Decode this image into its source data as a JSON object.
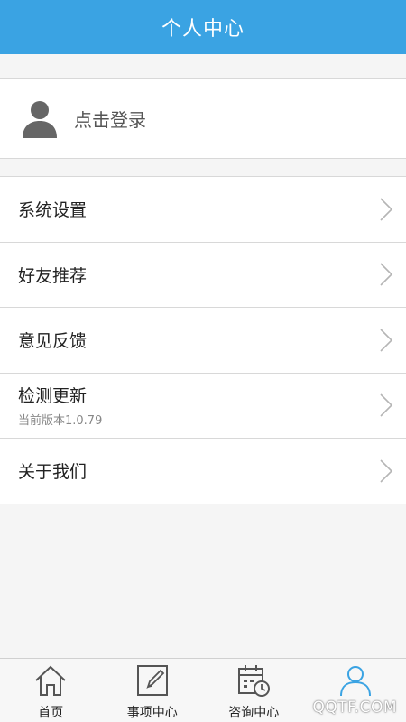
{
  "header": {
    "title": "个人中心"
  },
  "login": {
    "icon": "user-avatar-icon",
    "label": "点击登录"
  },
  "menu": {
    "items": [
      {
        "label": "系统设置",
        "sub": ""
      },
      {
        "label": "好友推荐",
        "sub": ""
      },
      {
        "label": "意见反馈",
        "sub": ""
      },
      {
        "label": "检测更新",
        "sub": "当前版本1.0.79"
      },
      {
        "label": "关于我们",
        "sub": ""
      }
    ]
  },
  "tabbar": {
    "tabs": [
      {
        "label": "首页",
        "icon": "home-icon"
      },
      {
        "label": "事项中心",
        "icon": "edit-icon"
      },
      {
        "label": "咨询中心",
        "icon": "calendar-clock-icon"
      },
      {
        "label": "",
        "icon": "person-icon",
        "active": true
      }
    ]
  },
  "watermark": "QQTF.COM",
  "colors": {
    "accent": "#3aa3e3",
    "divider": "#d8d8d8",
    "background": "#f5f5f5"
  }
}
